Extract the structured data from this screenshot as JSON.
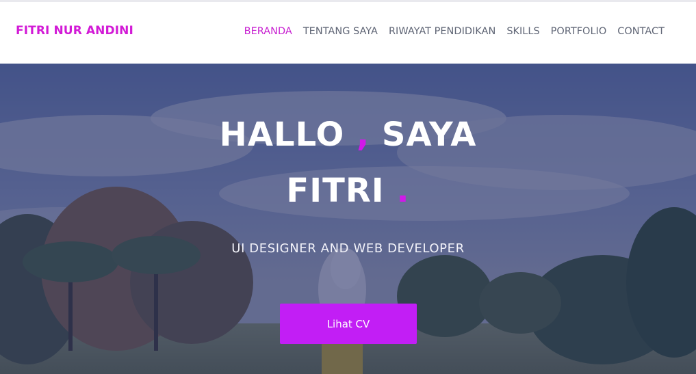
{
  "brand": {
    "name": "FITRI NUR ANDINI"
  },
  "nav": {
    "items": [
      {
        "label": "BERANDA",
        "active": true
      },
      {
        "label": "TENTANG SAYA",
        "active": false
      },
      {
        "label": "RIWAYAT PENDIDIKAN",
        "active": false
      },
      {
        "label": "SKILLS",
        "active": false
      },
      {
        "label": "PORTFOLIO",
        "active": false
      },
      {
        "label": "CONTACT",
        "active": false
      }
    ]
  },
  "hero": {
    "line1_a": "HALLO ",
    "line1_accent": ",",
    "line1_b": " SAYA",
    "line2_a": "FITRI ",
    "line2_accent": ".",
    "subtitle": "UI DESIGNER AND WEB DEVELOPER",
    "cta_label": "Lihat CV"
  },
  "colors": {
    "accent": "#d21ad6",
    "button": "#c21ef5",
    "nav_text": "#5f6575",
    "overlay": "#212a64"
  }
}
